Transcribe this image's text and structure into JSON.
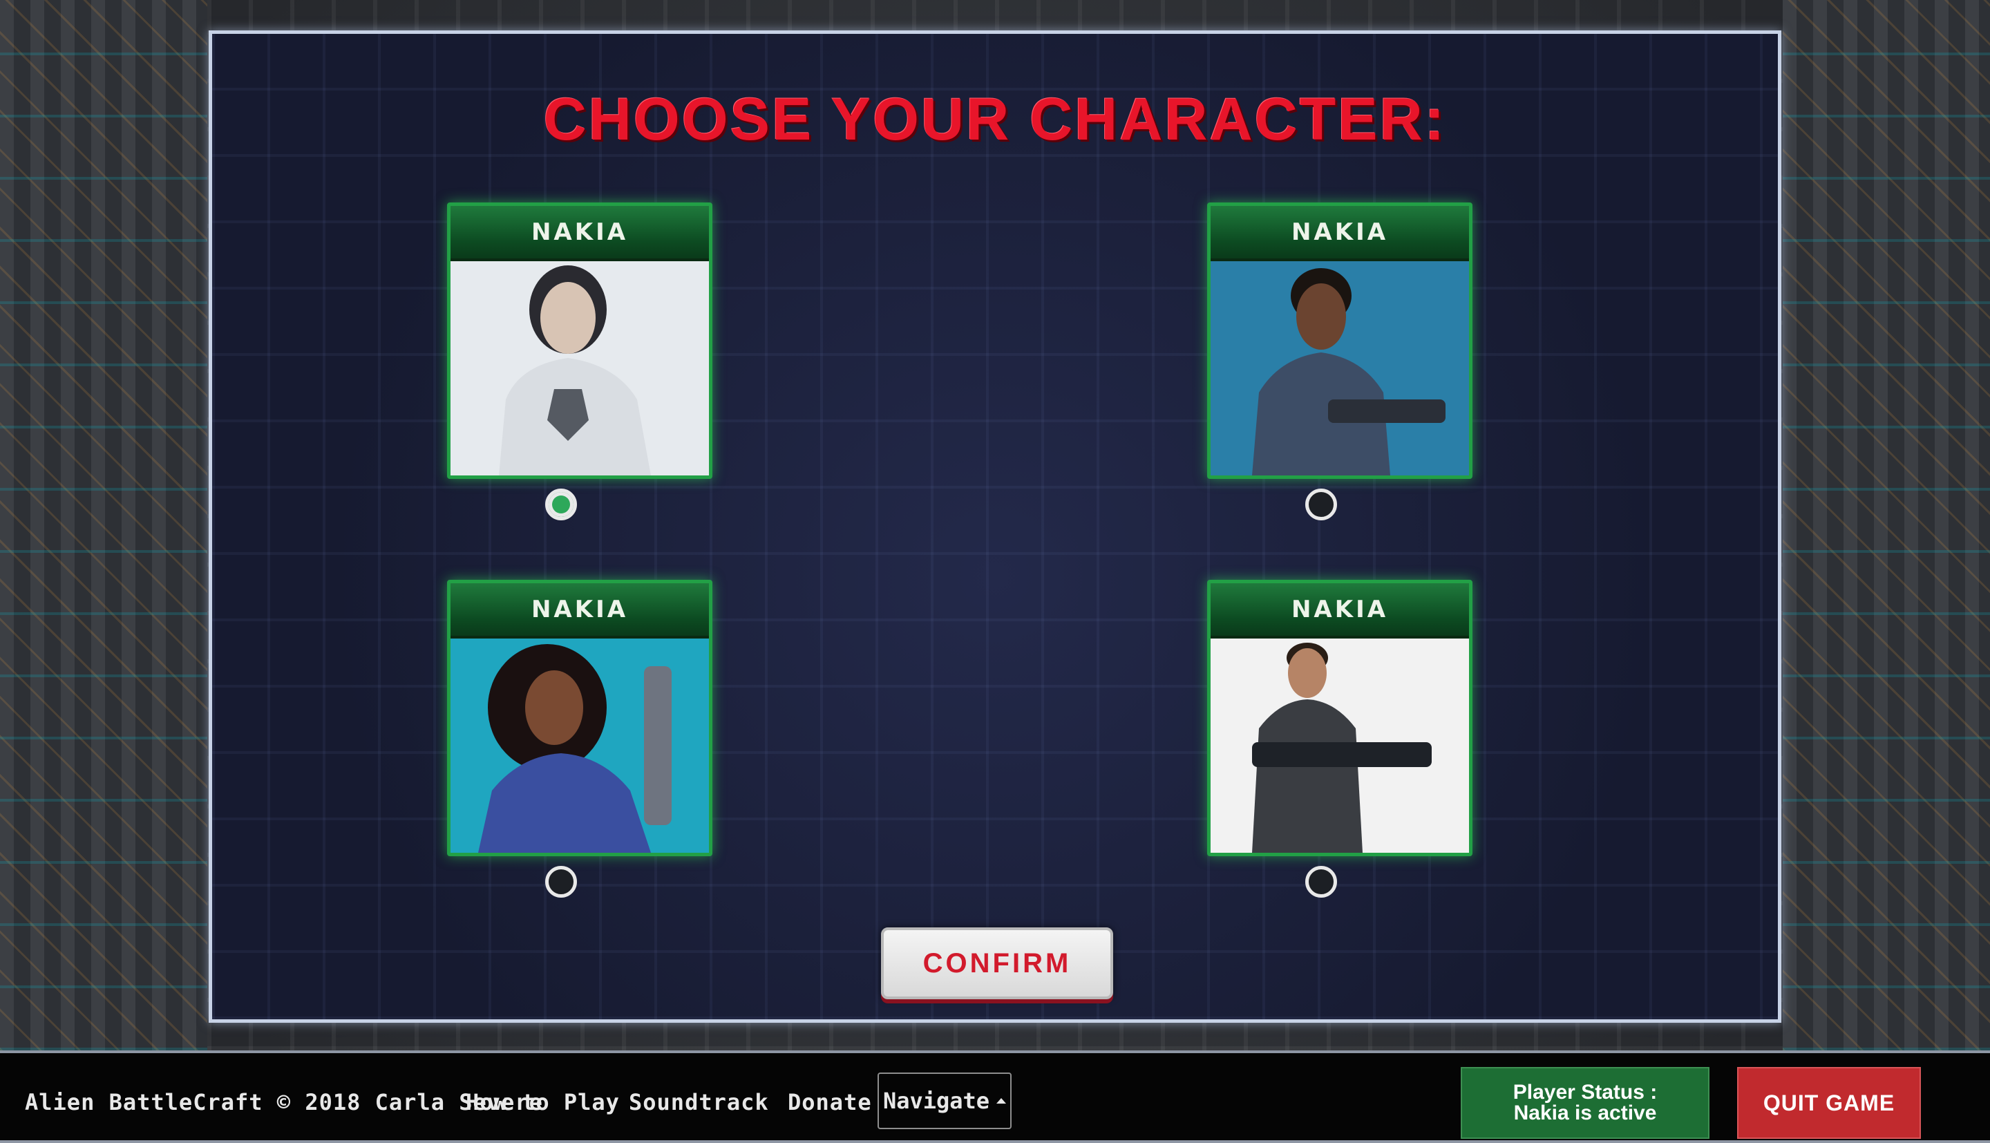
{
  "title": "CHOOSE YOUR CHARACTER:",
  "characters": [
    {
      "name": "NAKIA",
      "selected": true,
      "skin": "#d8c4b4",
      "suit": "#d9dde2",
      "bg": "#e6eaee",
      "hair": "#2a2a30"
    },
    {
      "name": "NAKIA",
      "selected": false,
      "skin": "#6b4430",
      "suit": "#3d4d66",
      "bg": "#2a7fa8",
      "hair": "#1a1410"
    },
    {
      "name": "NAKIA",
      "selected": false,
      "skin": "#7a4a32",
      "suit": "#3a4fa0",
      "bg": "#1fa6c0",
      "hair": "#1a1010"
    },
    {
      "name": "NAKIA",
      "selected": false,
      "skin": "#b68466",
      "suit": "#3a3d42",
      "bg": "#f2f2f2",
      "hair": "#2a1e16"
    }
  ],
  "confirm_label": "CONFIRM",
  "footer": {
    "credit": "Alien BattleCraft © 2018 Carla Severe",
    "how_to_play": "How to Play",
    "soundtrack": "Soundtrack",
    "donate": "Donate",
    "navigate": "Navigate",
    "status_line1": "Player Status :",
    "status_line2": "Nakia is active",
    "quit": "QUIT GAME"
  }
}
